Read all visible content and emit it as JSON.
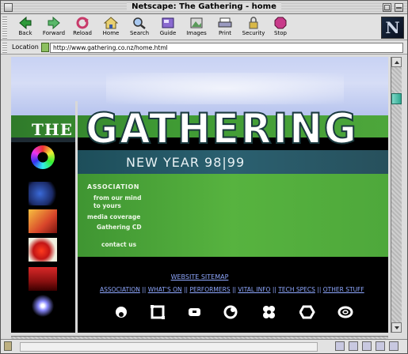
{
  "window": {
    "title": "Netscape: The Gathering - home"
  },
  "toolbar": {
    "buttons": [
      {
        "label": "Back",
        "icon": "back-arrow-icon"
      },
      {
        "label": "Forward",
        "icon": "forward-arrow-icon"
      },
      {
        "label": "Reload",
        "icon": "reload-icon"
      },
      {
        "label": "Home",
        "icon": "home-icon"
      },
      {
        "label": "Search",
        "icon": "search-icon"
      },
      {
        "label": "Guide",
        "icon": "guide-icon"
      },
      {
        "label": "Images",
        "icon": "images-icon"
      },
      {
        "label": "Print",
        "icon": "print-icon"
      },
      {
        "label": "Security",
        "icon": "security-lock-icon"
      },
      {
        "label": "Stop",
        "icon": "stop-icon"
      }
    ],
    "logo_letter": "N"
  },
  "location": {
    "label": "Location :",
    "url": "http://www.gathering.co.nz/home.html"
  },
  "page": {
    "banner": {
      "the": "THE",
      "gathering": "GATHERING",
      "subtitle": "NEW YEAR 98|99"
    },
    "side_links": {
      "association": "ASSOCIATION",
      "from_our_mind": "from our mind",
      "to_yours": "to yours",
      "media_coverage": "media coverage",
      "gathering_cd": "Gathering CD",
      "contact_us": "contact us"
    },
    "sitemap": "WEBSITE SITEMAP",
    "nav_links": [
      "ASSOCIATION",
      "WHAT'S ON",
      "PERFORMERS",
      "VITAL INFO",
      "TECH SPECS",
      "OTHER STUFF"
    ],
    "nav_separator": "||",
    "symbol_icons": [
      "circle-dot-icon",
      "square-frame-icon",
      "rounded-rect-icon",
      "spiral-icon",
      "clover-icon",
      "hexagon-icon",
      "ring-icon"
    ]
  },
  "colors": {
    "link": "#8fa8ff",
    "banner_green": "#4da63b",
    "banner_teal": "#2b6070",
    "page_background": "#000000"
  }
}
